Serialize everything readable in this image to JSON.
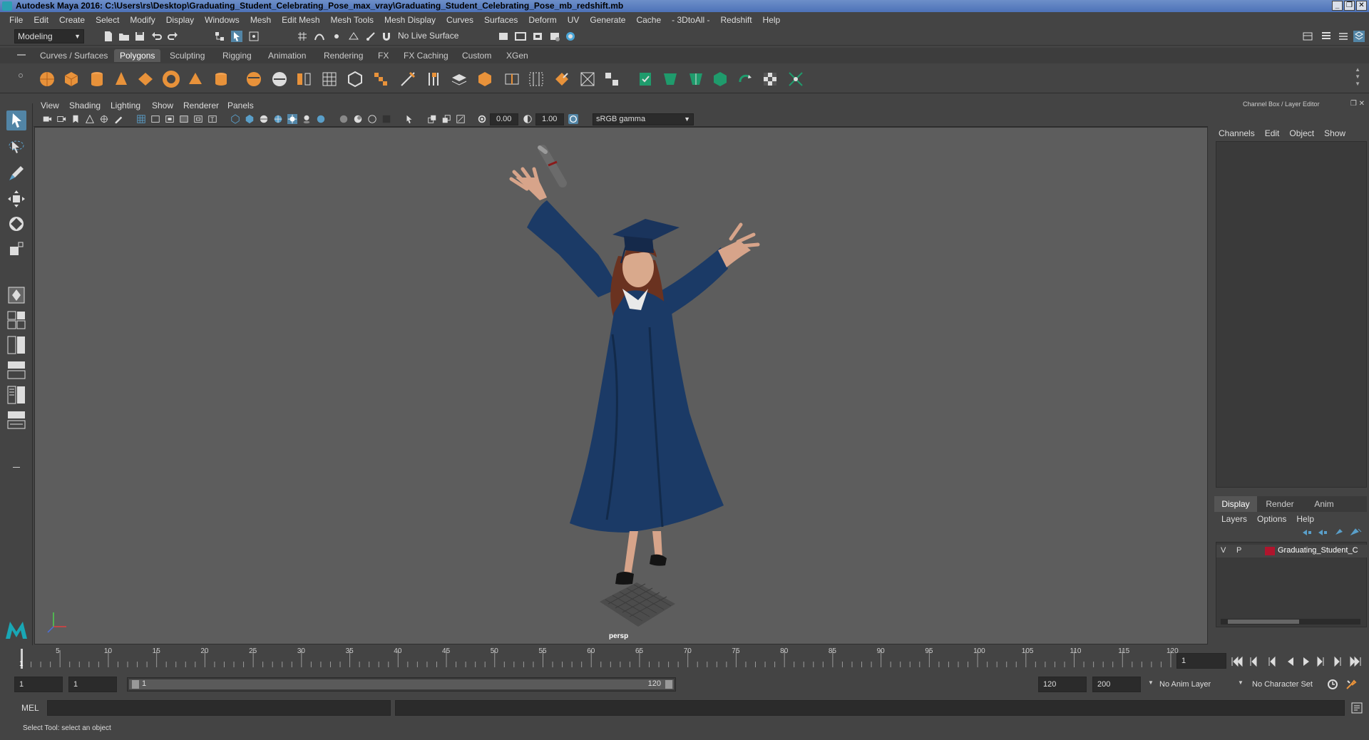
{
  "window": {
    "title": "Autodesk Maya 2016: C:\\Users\\rs\\Desktop\\Graduating_Student_Celebrating_Pose_max_vray\\Graduating_Student_Celebrating_Pose_mb_redshift.mb",
    "minimize": "_",
    "maximize": "❐",
    "close": "✕"
  },
  "menubar": [
    "File",
    "Edit",
    "Create",
    "Select",
    "Modify",
    "Display",
    "Windows",
    "Mesh",
    "Edit Mesh",
    "Mesh Tools",
    "Mesh Display",
    "Curves",
    "Surfaces",
    "Deform",
    "UV",
    "Generate",
    "Cache",
    "- 3DtoAll -",
    "Redshift",
    "Help"
  ],
  "statusline": {
    "mode": "Modeling",
    "live_surface": "No Live Surface"
  },
  "shelf": {
    "tabs": [
      "Curves / Surfaces",
      "Polygons",
      "Sculpting",
      "Rigging",
      "Animation",
      "Rendering",
      "FX",
      "FX Caching",
      "Custom",
      "XGen"
    ],
    "active_tab": "Polygons"
  },
  "panel_menu": [
    "View",
    "Shading",
    "Lighting",
    "Show",
    "Renderer",
    "Panels"
  ],
  "panel_toolbar": {
    "exposure": "0.00",
    "gamma": "1.00",
    "color_space": "sRGB gamma"
  },
  "viewport": {
    "camera_label": "persp"
  },
  "channel_box": {
    "title": "Channel Box / Layer Editor",
    "menu": [
      "Channels",
      "Edit",
      "Object",
      "Show"
    ],
    "layer_tabs": [
      "Display",
      "Render",
      "Anim"
    ],
    "active_layer_tab": "Display",
    "layer_menu": [
      "Layers",
      "Options",
      "Help"
    ],
    "layer": {
      "visible": "V",
      "playback": "P",
      "name": "Graduating_Student_C",
      "color": "#b0152d"
    }
  },
  "timeline": {
    "ticks": [
      "5",
      "10",
      "15",
      "20",
      "25",
      "30",
      "35",
      "40",
      "45",
      "50",
      "55",
      "60",
      "65",
      "70",
      "75",
      "80",
      "85",
      "90",
      "95",
      "100",
      "105",
      "110",
      "115",
      "120"
    ],
    "start_marker": "1",
    "current_frame": "1"
  },
  "range": {
    "start": "1",
    "playback_start": "1",
    "slider_start": "1",
    "slider_end": "120",
    "playback_end": "120",
    "end": "200",
    "anim_layer": "No Anim Layer",
    "character_set": "No Character Set"
  },
  "command_line": {
    "label": "MEL"
  },
  "help_line": {
    "text": "Select Tool: select an object"
  },
  "colors": {
    "accent": "#5285a6",
    "ui_bg": "#444444",
    "viewport_bg": "#5d5d5d",
    "gown": "#1b3a66",
    "shelf_orange": "#e8923a"
  }
}
